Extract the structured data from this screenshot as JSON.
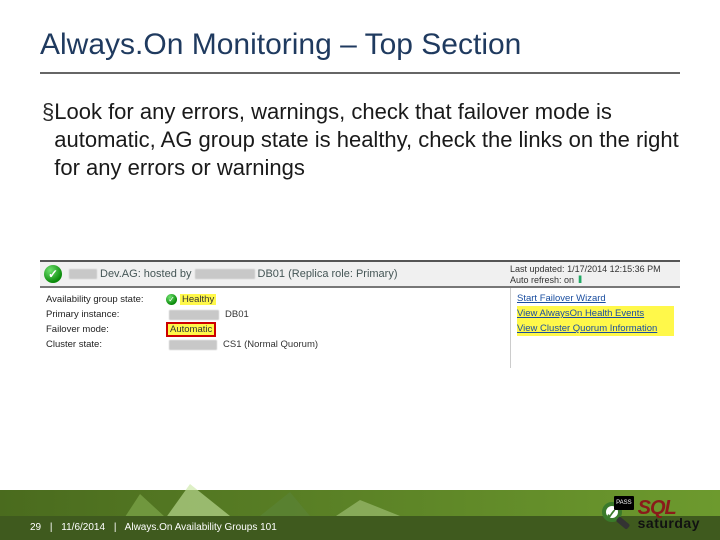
{
  "title": "Always.On Monitoring – Top Section",
  "bullet": "Look for any errors, warnings, check that failover mode is automatic, AG group state is healthy, check the links on the right for any errors or warnings",
  "screenshot": {
    "header_mid": "Dev.AG: hosted by",
    "header_tail": "DB01 (Replica role: Primary)",
    "last_updated_label": "Last updated:",
    "last_updated_value": "1/17/2014 12:15:36 PM",
    "auto_refresh_label": "Auto refresh: on",
    "rows": {
      "state_label": "Availability group state:",
      "state_value": "Healthy",
      "primary_label": "Primary instance:",
      "primary_value_tail": "DB01",
      "failover_label": "Failover mode:",
      "failover_value": "Automatic",
      "cluster_label": "Cluster state:",
      "cluster_value_tail": "CS1  (Normal Quorum)"
    },
    "links": {
      "l1": "Start Failover Wizard",
      "l2": "View AlwaysOn Health Events",
      "l3": "View Cluster Quorum Information"
    }
  },
  "footer": {
    "page": "29",
    "date": "11/6/2014",
    "deck": "Always.On Availability Groups 101"
  },
  "logo": {
    "sql": "SQL",
    "saturday": "saturday",
    "pass": "PASS"
  }
}
